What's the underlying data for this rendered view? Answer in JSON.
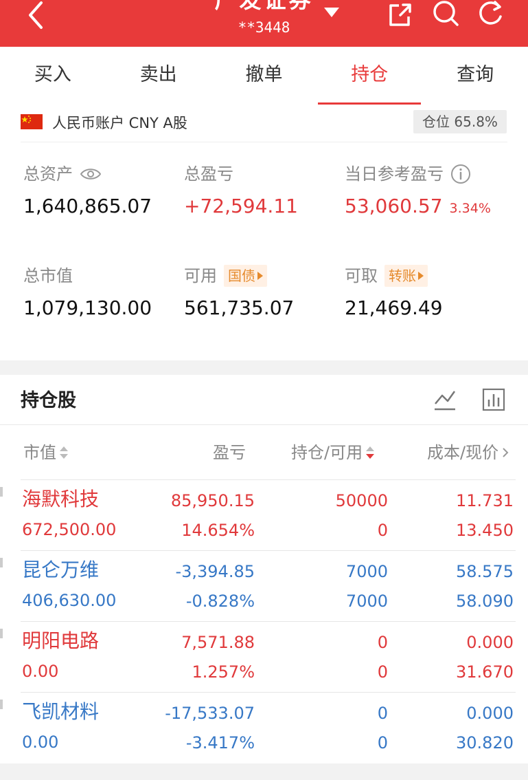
{
  "header": {
    "title": "广发证券",
    "account": "**3448"
  },
  "tabs": [
    {
      "label": "买入"
    },
    {
      "label": "卖出"
    },
    {
      "label": "撤单"
    },
    {
      "label": "持仓"
    },
    {
      "label": "查询"
    }
  ],
  "active_tab": "持仓",
  "account": {
    "label": "人民币账户 CNY A股",
    "position_badge": "仓位 65.8%"
  },
  "stats": {
    "total_assets": {
      "label": "总资产",
      "value": "1,640,865.07"
    },
    "total_pnl": {
      "label": "总盈亏",
      "value": "+72,594.11"
    },
    "daily_pnl": {
      "label": "当日参考盈亏",
      "value": "53,060.57",
      "pct": "3.34%"
    },
    "market_value": {
      "label": "总市值",
      "value": "1,079,130.00"
    },
    "available": {
      "label": "可用",
      "value": "561,735.07",
      "tag": "国债"
    },
    "withdrawable": {
      "label": "可取",
      "value": "21,469.49",
      "tag": "转账"
    }
  },
  "holdings": {
    "title": "持仓股",
    "columns": {
      "market_value": "市值",
      "pnl": "盈亏",
      "position": "持仓/可用",
      "cost": "成本/现价"
    },
    "rows": [
      {
        "name": "海默科技",
        "market_value": "672,500.00",
        "pnl": "85,950.15",
        "pnl_pct": "14.654%",
        "position": "50000",
        "available": "0",
        "cost": "11.731",
        "price": "13.450",
        "color": "#e0393b"
      },
      {
        "name": "昆仑万维",
        "market_value": "406,630.00",
        "pnl": "-3,394.85",
        "pnl_pct": "-0.828%",
        "position": "7000",
        "available": "7000",
        "cost": "58.575",
        "price": "58.090",
        "color": "#3778c6"
      },
      {
        "name": "明阳电路",
        "market_value": "0.00",
        "pnl": "7,571.88",
        "pnl_pct": "1.257%",
        "position": "0",
        "available": "0",
        "cost": "0.000",
        "price": "31.670",
        "color": "#e0393b"
      },
      {
        "name": "飞凯材料",
        "market_value": "0.00",
        "pnl": "-17,533.07",
        "pnl_pct": "-3.417%",
        "position": "0",
        "available": "0",
        "cost": "0.000",
        "price": "30.820",
        "color": "#3778c6"
      }
    ]
  },
  "colors": {
    "brand_red": "#e83a3a",
    "gain": "#e0393b",
    "loss": "#3778c6",
    "tag_orange": "#e58a2c"
  },
  "icons": [
    "back-arrow-icon",
    "dropdown-caret-icon",
    "share-icon",
    "search-icon",
    "refresh-icon",
    "china-flag-icon",
    "eye-icon",
    "info-icon",
    "line-chart-icon",
    "bar-chart-icon",
    "sort-icon"
  ]
}
